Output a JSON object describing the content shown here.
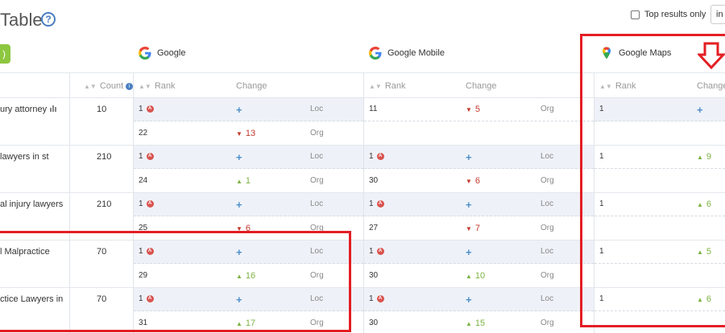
{
  "header": {
    "title": "Table",
    "help_glyph": "?",
    "top_results_label": "Top results only",
    "scope_value": "in t"
  },
  "engines": [
    {
      "name": "Google"
    },
    {
      "name": "Google Mobile"
    },
    {
      "name": "Google Maps"
    }
  ],
  "columns": {
    "count": "Count",
    "info_glyph": "i",
    "rank": "Rank",
    "change": "Change"
  },
  "rows": [
    {
      "keyword": "ury attorney",
      "count": "10",
      "google": {
        "loc": {
          "rank": "1",
          "change": "+",
          "dir": "new",
          "type": "Loc"
        },
        "org": {
          "rank": "22",
          "change": "13",
          "dir": "down",
          "type": "Org"
        }
      },
      "mobile": {
        "loc": {
          "rank": "11",
          "change": "5",
          "dir": "down",
          "type": "Org"
        },
        "org": {
          "rank": "",
          "change": "",
          "dir": "",
          "type": ""
        }
      },
      "maps": {
        "rank": "1",
        "change": "+",
        "dir": "new"
      }
    },
    {
      "keyword": "lawyers in st",
      "count": "210",
      "google": {
        "loc": {
          "rank": "1",
          "change": "+",
          "dir": "new",
          "type": "Loc"
        },
        "org": {
          "rank": "24",
          "change": "1",
          "dir": "up",
          "type": "Org"
        }
      },
      "mobile": {
        "loc": {
          "rank": "1",
          "change": "+",
          "dir": "new",
          "type": "Loc"
        },
        "org": {
          "rank": "30",
          "change": "6",
          "dir": "down",
          "type": "Org"
        }
      },
      "maps": {
        "rank": "1",
        "change": "9",
        "dir": "up"
      }
    },
    {
      "keyword": "al injury lawyers",
      "count": "210",
      "google": {
        "loc": {
          "rank": "1",
          "change": "+",
          "dir": "new",
          "type": "Loc"
        },
        "org": {
          "rank": "25",
          "change": "6",
          "dir": "down",
          "type": "Org"
        }
      },
      "mobile": {
        "loc": {
          "rank": "1",
          "change": "+",
          "dir": "new",
          "type": "Loc"
        },
        "org": {
          "rank": "27",
          "change": "7",
          "dir": "down",
          "type": "Org"
        }
      },
      "maps": {
        "rank": "1",
        "change": "6",
        "dir": "up"
      }
    },
    {
      "keyword": "l Malpractice",
      "count": "70",
      "google": {
        "loc": {
          "rank": "1",
          "change": "+",
          "dir": "new",
          "type": "Loc"
        },
        "org": {
          "rank": "29",
          "change": "16",
          "dir": "up",
          "type": "Org"
        }
      },
      "mobile": {
        "loc": {
          "rank": "1",
          "change": "+",
          "dir": "new",
          "type": "Loc"
        },
        "org": {
          "rank": "30",
          "change": "10",
          "dir": "up",
          "type": "Org"
        }
      },
      "maps": {
        "rank": "1",
        "change": "5",
        "dir": "up"
      }
    },
    {
      "keyword": "ctice Lawyers in",
      "count": "70",
      "google": {
        "loc": {
          "rank": "1",
          "change": "+",
          "dir": "new",
          "type": "Loc"
        },
        "org": {
          "rank": "31",
          "change": "17",
          "dir": "up",
          "type": "Org"
        }
      },
      "mobile": {
        "loc": {
          "rank": "1",
          "change": "+",
          "dir": "new",
          "type": "Loc"
        },
        "org": {
          "rank": "30",
          "change": "15",
          "dir": "up",
          "type": "Org"
        }
      },
      "maps": {
        "rank": "1",
        "change": "6",
        "dir": "up"
      }
    }
  ],
  "colors": {
    "accent_blue": "#4a7fc1",
    "up_green": "#7cb342",
    "down_red": "#c0392b",
    "badge_red": "#d9534f",
    "highlight_red": "#e31e24",
    "band_blue": "#eef2f8"
  },
  "icons": {
    "help": "help-icon",
    "google": "google-g-icon",
    "maps": "google-maps-pin-icon",
    "trend": "trend-bars-icon",
    "arrow": "down-arrow-icon"
  }
}
